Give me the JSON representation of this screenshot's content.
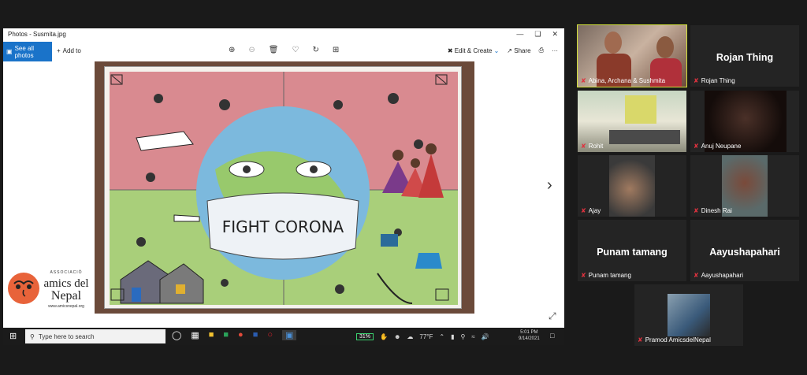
{
  "photos_app": {
    "window_title": "Photos - Susmita.jpg",
    "see_all": "See all photos",
    "add_to": "Add to",
    "edit_create": "Edit & Create",
    "share": "Share",
    "more": "···"
  },
  "drawing": {
    "caption": "FIGHT CORONA"
  },
  "logo": {
    "line1": "ASSOCIACIÓ",
    "line2": "amics del",
    "line3": "Nepal",
    "url": "www.amicsnepal.org"
  },
  "taskbar": {
    "search_placeholder": "Type here to search",
    "battery": "31%",
    "weather": "77°F",
    "time": "5:01 PM",
    "date": "9/14/2021"
  },
  "participants": [
    {
      "name": "Abina, Archana & Sushmita"
    },
    {
      "name": "Rojan Thing",
      "display": "Rojan Thing"
    },
    {
      "name": "Rohit"
    },
    {
      "name": "Anuj Neupane"
    },
    {
      "name": "Ajay"
    },
    {
      "name": "Dinesh Rai"
    },
    {
      "name": "Punam tamang",
      "display": "Punam tamang"
    },
    {
      "name": "Aayushapahari",
      "display": "Aayushapahari"
    },
    {
      "name": "Pramod AmicsdelNepal"
    }
  ],
  "colors": {
    "active_speaker": "#d3e23a",
    "see_all_bg": "#1a73c9",
    "muted_mic": "#e0323f"
  }
}
